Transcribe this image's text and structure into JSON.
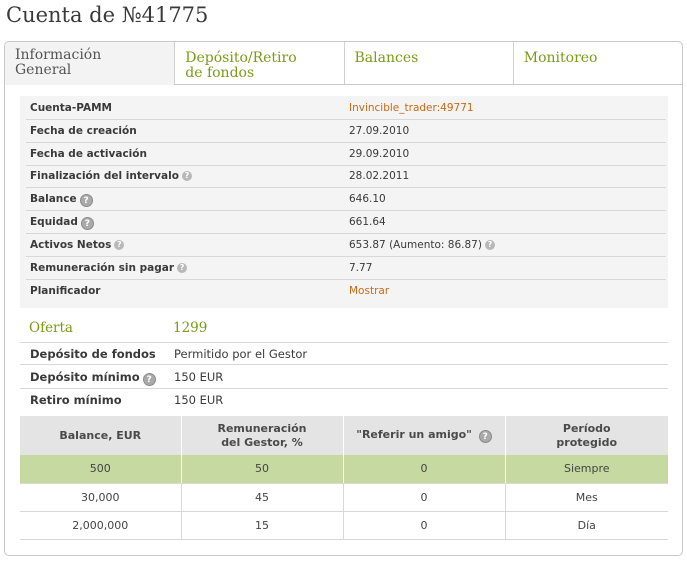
{
  "page": {
    "title": "Cuenta de №41775"
  },
  "tabs": [
    {
      "label": "Información General",
      "line1": "Información",
      "line2": "General",
      "active": true
    },
    {
      "label": "Depósito/Retiro de fondos",
      "line1": "Depósito/Retiro",
      "line2": "de fondos",
      "active": false
    },
    {
      "label": "Balances",
      "line1": "Balances",
      "line2": "",
      "active": false
    },
    {
      "label": "Monitoreo",
      "line1": "Monitoreo",
      "line2": "",
      "active": false
    }
  ],
  "info": {
    "rows": [
      {
        "label": "Cuenta-PAMM",
        "value": "Invincible_trader:49771",
        "link": true
      },
      {
        "label": "Fecha de creación",
        "value": "27.09.2010"
      },
      {
        "label": "Fecha de activación",
        "value": "29.09.2010"
      },
      {
        "label": "Finalización del intervalo",
        "value": "28.02.2011",
        "help": true
      },
      {
        "label": "Balance",
        "value": "646.10",
        "help": true
      },
      {
        "label": "Equidad",
        "value": "661.64",
        "help": true
      },
      {
        "label": "Activos Netos",
        "value": "653.87 (Aumento: 86.87)",
        "help": true,
        "value_help": true
      },
      {
        "label": "Remuneración sin pagar",
        "value": "7.77",
        "help": true
      },
      {
        "label": "Planificador",
        "value": "Mostrar",
        "link": true
      }
    ]
  },
  "offer": {
    "title": "Oferta",
    "number": "1299",
    "rows": [
      {
        "label": "Depósito de fondos",
        "value": "Permitido por el Gestor"
      },
      {
        "label": "Depósito mínimo",
        "value": "150 EUR",
        "help": true
      },
      {
        "label": "Retiro mínimo",
        "value": "150 EUR"
      }
    ]
  },
  "fee_table": {
    "headers": [
      {
        "line1": "Balance, EUR",
        "line2": ""
      },
      {
        "line1": "Remuneración",
        "line2": "del Gestor, %"
      },
      {
        "line1": "\"Referir un amigo\"",
        "line2": ""
      },
      {
        "line1": "Período",
        "line2": "protegido"
      }
    ],
    "rows": [
      [
        "500",
        "50",
        "0",
        "Siempre"
      ],
      [
        "30,000",
        "45",
        "0",
        "Mes"
      ],
      [
        "2,000,000",
        "15",
        "0",
        "Día"
      ]
    ]
  },
  "colors": {
    "accent_green": "#7a9b16",
    "link_orange": "#c86a14",
    "highlight_row": "#c5d9a1"
  },
  "icons": {
    "help": "help-icon"
  }
}
